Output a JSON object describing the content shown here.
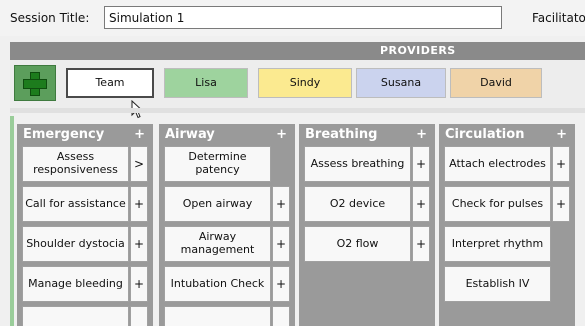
{
  "session": {
    "title_label": "Session Title:",
    "title_value": "Simulation 1",
    "facilitator_label": "Facilitator"
  },
  "providers": {
    "bar_title": "PROVIDERS",
    "add_icon": "plus-icon",
    "items": [
      {
        "label": "Team",
        "color": "#ffffff"
      },
      {
        "label": "Lisa",
        "color": "#9ed39e"
      },
      {
        "label": "Sindy",
        "color": "#fbea90"
      },
      {
        "label": "Susana",
        "color": "#cbd3ee"
      },
      {
        "label": "David",
        "color": "#f0d3a8"
      }
    ]
  },
  "columns": [
    {
      "title": "Emergency",
      "plus": "+",
      "items": [
        {
          "label": "Assess responsiveness",
          "action": ">"
        },
        {
          "label": "Call for assistance",
          "action": "+"
        },
        {
          "label": "Shoulder dystocia",
          "action": "+"
        },
        {
          "label": "Manage bleeding",
          "action": "+"
        }
      ]
    },
    {
      "title": "Airway",
      "plus": "+",
      "items": [
        {
          "label": "Determine patency",
          "action": ""
        },
        {
          "label": "Open airway",
          "action": "+"
        },
        {
          "label": "Airway management",
          "action": "+"
        },
        {
          "label": "Intubation Check",
          "action": "+"
        }
      ]
    },
    {
      "title": "Breathing",
      "plus": "+",
      "items": [
        {
          "label": "Assess breathing",
          "action": "+"
        },
        {
          "label": "O2 device",
          "action": "+"
        },
        {
          "label": "O2 flow",
          "action": "+"
        }
      ]
    },
    {
      "title": "Circulation",
      "plus": "+",
      "items": [
        {
          "label": "Attach electrodes",
          "action": "+"
        },
        {
          "label": "Check for pulses",
          "action": "+"
        },
        {
          "label": "Interpret rhythm",
          "action": ""
        },
        {
          "label": "Establish IV",
          "action": ""
        }
      ]
    }
  ]
}
